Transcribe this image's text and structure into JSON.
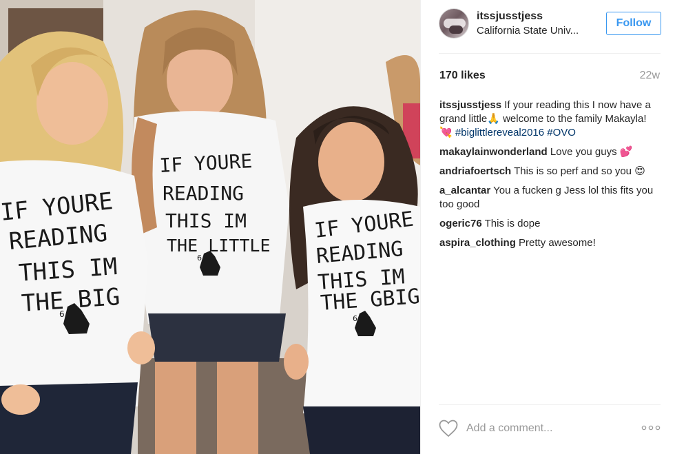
{
  "post": {
    "shirt_left": [
      "IF YOURE",
      "READING",
      "THIS IM",
      "THE BIG"
    ],
    "shirt_middle": [
      "IF YOURE",
      "READING",
      "THIS IM",
      "THE LITTLE"
    ],
    "shirt_right": [
      "IF YOURE",
      "READING",
      "THIS IM",
      "THE GBIG"
    ],
    "shirt_numeral": "6"
  },
  "header": {
    "username": "itssjusstjess",
    "location": "California State Univ...",
    "follow_label": "Follow"
  },
  "stats": {
    "likes": "170 likes",
    "time": "22w"
  },
  "caption": {
    "user": "itssjusstjess",
    "text_1": "If your reading this I now have a grand little",
    "emoji_1": "🙏",
    "text_2": "welcome to the family Makayla!",
    "emoji_2": "💘",
    "hashtag_1": "#biglittlereveal2016",
    "hashtag_2": "#OVO"
  },
  "comments": [
    {
      "user": "makaylainwonderland",
      "text": "Love you guys",
      "emoji": "💕"
    },
    {
      "user": "andriafoertsch",
      "text": "This is so perf and so you",
      "emoji": "😍"
    },
    {
      "user": "a_alcantar",
      "text": "You a fucken g Jess lol this fits you too good"
    },
    {
      "user": "ogeric76",
      "text": "This is dope"
    },
    {
      "user": "aspira_clothing",
      "text": "Pretty awesome!"
    }
  ],
  "comment_box": {
    "placeholder": "Add a comment..."
  },
  "icons": {
    "like": "heart-outline-icon",
    "more": "more-options-icon"
  },
  "colors": {
    "accent": "#3897f0",
    "hashtag": "#003569",
    "muted": "#999999"
  }
}
